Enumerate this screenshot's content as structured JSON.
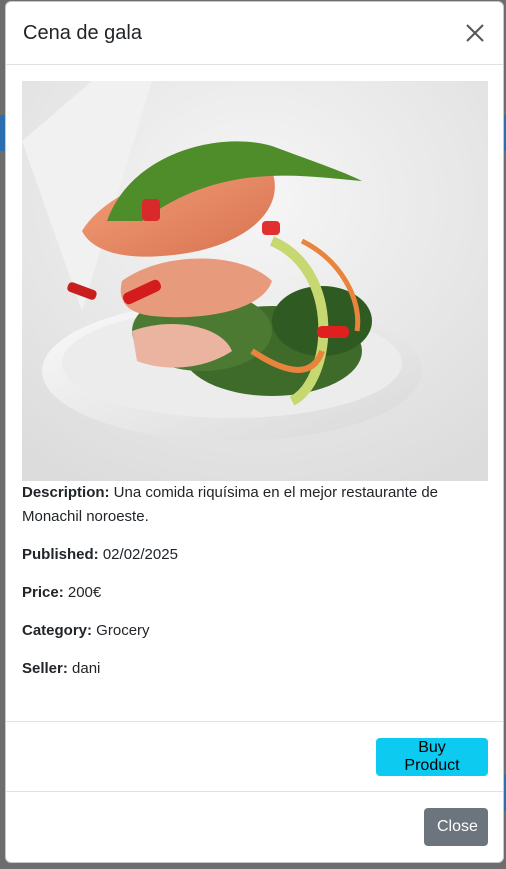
{
  "modal": {
    "title": "Cena de gala",
    "close_icon": "close-icon"
  },
  "product": {
    "image_alt": "Salmon and greens served on a white spoon",
    "description_label": "Description:",
    "description": " Una comida riquísima en el mejor restaurante de Monachil noroeste.",
    "published_label": "Published:",
    "published": " 02/02/2025",
    "price_label": "Price:",
    "price": " 200€",
    "category_label": "Category:",
    "category": " Grocery",
    "seller_label": "Seller:",
    "seller": " dani"
  },
  "buttons": {
    "buy_label": "Buy Product",
    "close_label": "Close"
  },
  "colors": {
    "buy_button": "#0dcaf0",
    "close_button": "#6c757d",
    "divider": "#dee2e6"
  }
}
